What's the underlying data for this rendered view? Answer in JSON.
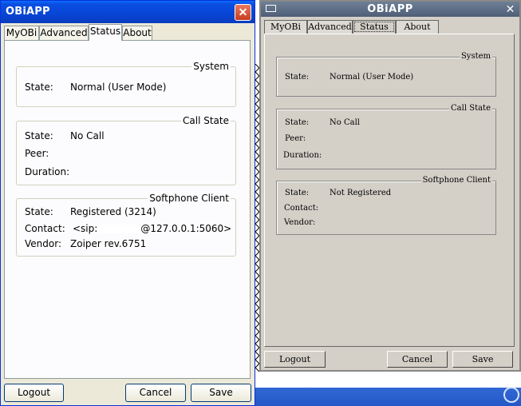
{
  "left_window": {
    "title": "OBiAPP",
    "close_glyph": "✕",
    "tabs": [
      "MyOBi",
      "Advanced",
      "Status",
      "About"
    ],
    "active_tab": "Status",
    "groups": {
      "system": {
        "title": "System",
        "state_label": "State:",
        "state_value": "Normal (User Mode)"
      },
      "call_state": {
        "title": "Call State",
        "state_label": "State:",
        "state_value": "No Call",
        "peer_label": "Peer:",
        "duration_label": "Duration:"
      },
      "softphone": {
        "title": "Softphone Client",
        "state_label": "State:",
        "state_value": "Registered (3214)",
        "contact_label": "Contact:",
        "contact_prefix": "<sip:",
        "contact_suffix": "@127.0.0.1:5060>",
        "vendor_label": "Vendor:",
        "vendor_value": "Zoiper rev.6751"
      }
    },
    "buttons": {
      "logout": "Logout",
      "cancel": "Cancel",
      "save": "Save"
    }
  },
  "right_window": {
    "title": "OBiAPP",
    "close_glyph": "✕",
    "tabs": [
      "MyOBi",
      "Advanced",
      "Status",
      "About"
    ],
    "active_tab": "Status",
    "groups": {
      "system": {
        "title": "System",
        "state_label": "State:",
        "state_value": "Normal (User Mode)"
      },
      "call_state": {
        "title": "Call State",
        "state_label": "State:",
        "state_value": "No Call",
        "peer_label": "Peer:",
        "duration_label": "Duration:"
      },
      "softphone": {
        "title": "Softphone Client",
        "state_label": "State:",
        "state_value": "Not Registered",
        "contact_label": "Contact:",
        "vendor_label": "Vendor:"
      }
    },
    "buttons": {
      "logout": "Logout",
      "cancel": "Cancel",
      "save": "Save"
    }
  },
  "icons": {
    "left_close": "close-icon",
    "right_close": "close-icon",
    "right_system_menu": "window-menu-icon"
  }
}
